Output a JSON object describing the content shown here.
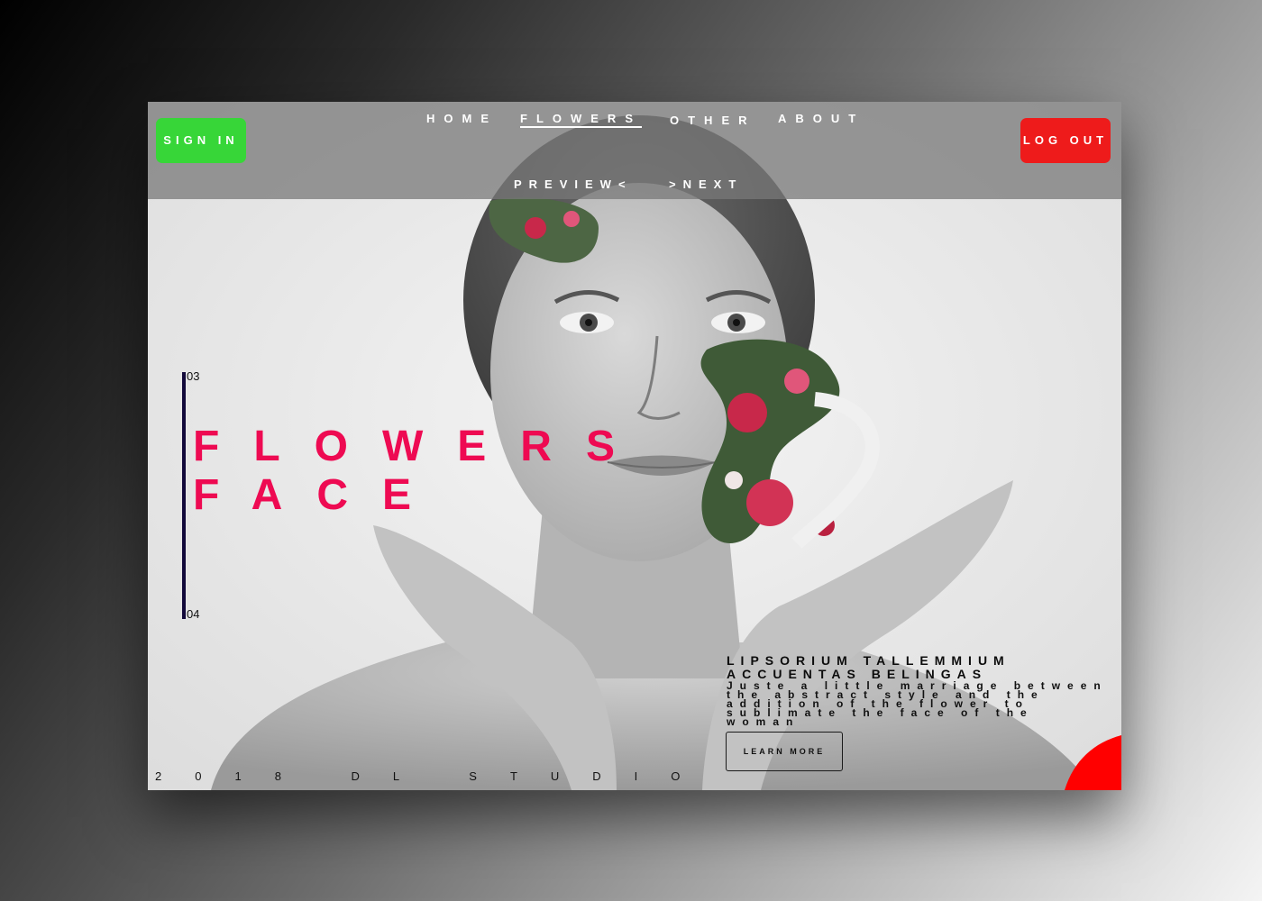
{
  "header": {
    "sign_in_label": "SIGN IN",
    "log_out_label": "LOG OUT",
    "nav": [
      {
        "label": "HOME",
        "active": false
      },
      {
        "label": "FLOWERS",
        "active": true
      },
      {
        "label": "OTHER",
        "active": false
      },
      {
        "label": "ABOUT",
        "active": false
      }
    ],
    "pager": {
      "prev_label": "PREVIEW<",
      "next_label": ">NEXT"
    }
  },
  "hero": {
    "index_top": "03",
    "index_bottom": "04",
    "title_line1": "FLOWERS",
    "title_line2": "FACE"
  },
  "promo": {
    "heading": "LIPSORIUM TALLEMMIUM ACCUENTAS BELINGAS",
    "body": "Juste a little marriage between the abstract style and the addition of the flower to sublimate the face of the woman",
    "cta_label": "LEARN MORE"
  },
  "footer": {
    "credit": "2018 DL STUDIO"
  },
  "colors": {
    "accent_title": "#ee0a52",
    "sign_in_bg": "#37d638",
    "log_out_bg": "#ee1b1b",
    "index_bar": "#12093a",
    "corner_accent": "#ff0000"
  },
  "icons": {
    "hero_image": "portrait-with-flowers-image",
    "corner_shape": "red-quarter-circle"
  }
}
